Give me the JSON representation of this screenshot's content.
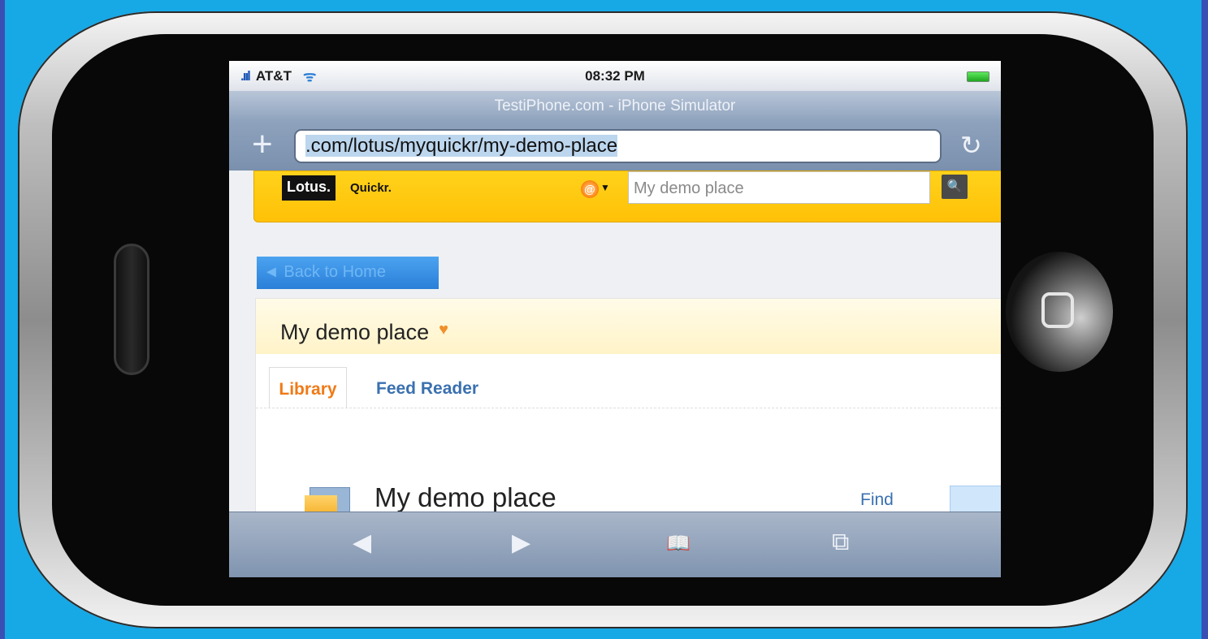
{
  "status_bar": {
    "signal": ".ııl",
    "carrier": "AT&T",
    "wifi": "ᯤ",
    "time": "08:32 PM"
  },
  "browser": {
    "window_title": "TestiPhone.com - iPhone Simulator",
    "url": ".com/lotus/myquickr/my-demo-place",
    "add_icon": "+",
    "reload_icon": "↻"
  },
  "quickr_header": {
    "logo_lotus": "Lotus.",
    "logo_quickr": "Quickr.",
    "search_placeholder": "My demo place",
    "search_icon": "🔍"
  },
  "nav": {
    "back_label": "◄ Back to Home"
  },
  "place": {
    "title": "My demo place",
    "favorite_icon": "♥",
    "tabs": [
      {
        "label": "Library"
      },
      {
        "label": "Feed Reader"
      }
    ],
    "library_title": "My demo place",
    "find_label": "Find"
  },
  "toolbar": {
    "back": "◀",
    "forward": "▶",
    "bookmarks": "📖",
    "pages": "⧉"
  }
}
